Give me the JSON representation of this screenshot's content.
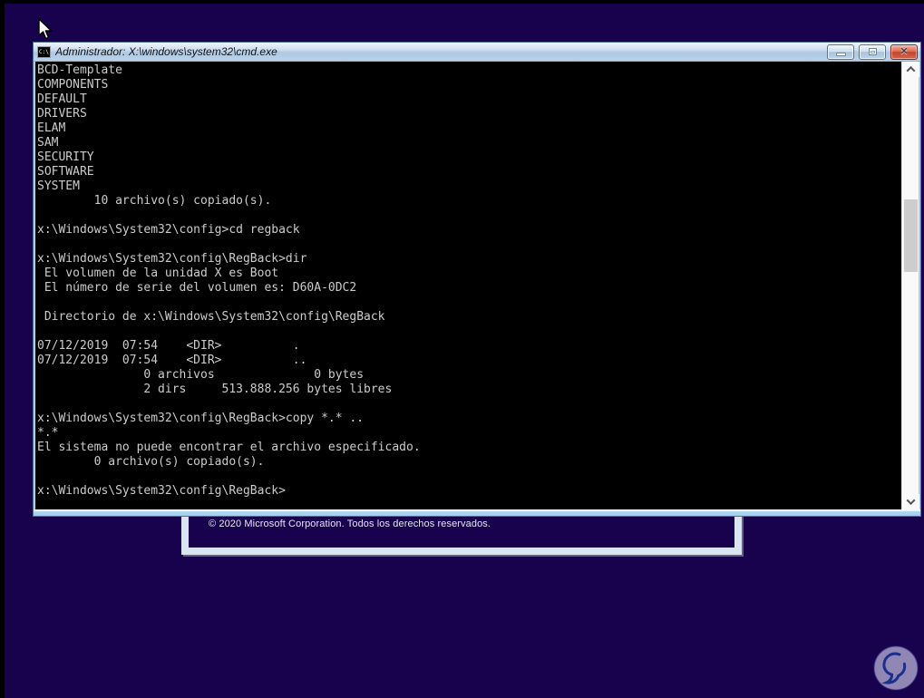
{
  "desktop": {
    "background_color": "#18024e"
  },
  "window": {
    "title": "Administrador: X:\\windows\\system32\\cmd.exe",
    "icon_text": "C:\\",
    "controls": {
      "close_glyph": "✕"
    }
  },
  "console": {
    "background_color": "#000000",
    "text_color": "#cccccc",
    "lines": [
      "BCD-Template",
      "COMPONENTS",
      "DEFAULT",
      "DRIVERS",
      "ELAM",
      "SAM",
      "SECURITY",
      "SOFTWARE",
      "SYSTEM",
      "        10 archivo(s) copiado(s).",
      "",
      "x:\\Windows\\System32\\config>cd regback",
      "",
      "x:\\Windows\\System32\\config\\RegBack>dir",
      " El volumen de la unidad X es Boot",
      " El número de serie del volumen es: D60A-0DC2",
      "",
      " Directorio de x:\\Windows\\System32\\config\\RegBack",
      "",
      "07/12/2019  07:54    <DIR>          .",
      "07/12/2019  07:54    <DIR>          ..",
      "               0 archivos              0 bytes",
      "               2 dirs     513.888.256 bytes libres",
      "",
      "x:\\Windows\\System32\\config\\RegBack>copy *.* ..",
      "*.*",
      "El sistema no puede encontrar el archivo especificado.",
      "        0 archivo(s) copiado(s).",
      "",
      "x:\\Windows\\System32\\config\\RegBack>"
    ]
  },
  "dialog": {
    "copyright": "© 2020 Microsoft Corporation. Todos los derechos reservados."
  }
}
